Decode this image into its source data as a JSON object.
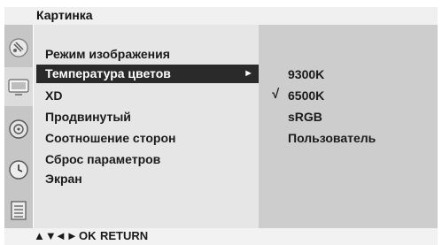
{
  "menu": {
    "title": "Картинка",
    "items": [
      {
        "label": "Режим изображения"
      },
      {
        "label": "Температура цветов",
        "arrow": "►"
      },
      {
        "label": "XD"
      },
      {
        "label": "Продвинутый"
      },
      {
        "label": "Соотношение сторон"
      },
      {
        "label": "Сброс параметров"
      },
      {
        "label": "Экран"
      }
    ],
    "selected_index": 1
  },
  "submenu": {
    "options": [
      "9300K",
      "6500K",
      "sRGB",
      "Пользователь"
    ],
    "checked_index": 1,
    "check_mark": "√"
  },
  "icons": [
    "satellite-icon",
    "tv-picture-icon",
    "speaker-icon",
    "clock-icon",
    "settings-list-icon"
  ],
  "footer": {
    "up_down": "▲▼",
    "left_right": "◄►",
    "ok": "OK",
    "return": "RETURN"
  },
  "colors": {
    "highlight_bg": "#2a2a2a",
    "highlight_text": "#ffffff"
  }
}
